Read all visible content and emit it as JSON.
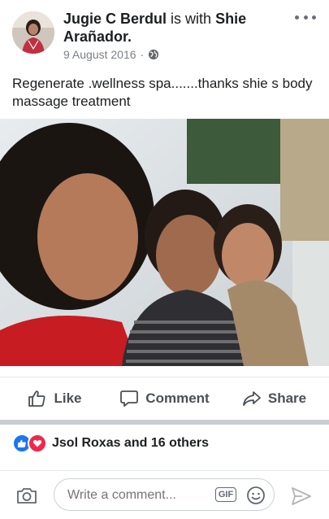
{
  "post": {
    "author": "Jugie C Berdul",
    "with_text": "is with",
    "tagged": "Shie Arañador.",
    "date": "9 August 2016",
    "separator": "·",
    "text": "Regenerate .wellness spa.......thanks shie s body massage treatment"
  },
  "actions": {
    "like_label": "Like",
    "comment_label": "Comment",
    "share_label": "Share"
  },
  "reactions": {
    "summary": "Jsol Roxas and 16 others"
  },
  "composer": {
    "placeholder": "Write a comment...",
    "gif_label": "GIF"
  },
  "colors": {
    "like_blue": "#1877f2",
    "love_red": "#f0284a",
    "icon_gray": "#606770",
    "meta_gray": "#7b7f86"
  }
}
